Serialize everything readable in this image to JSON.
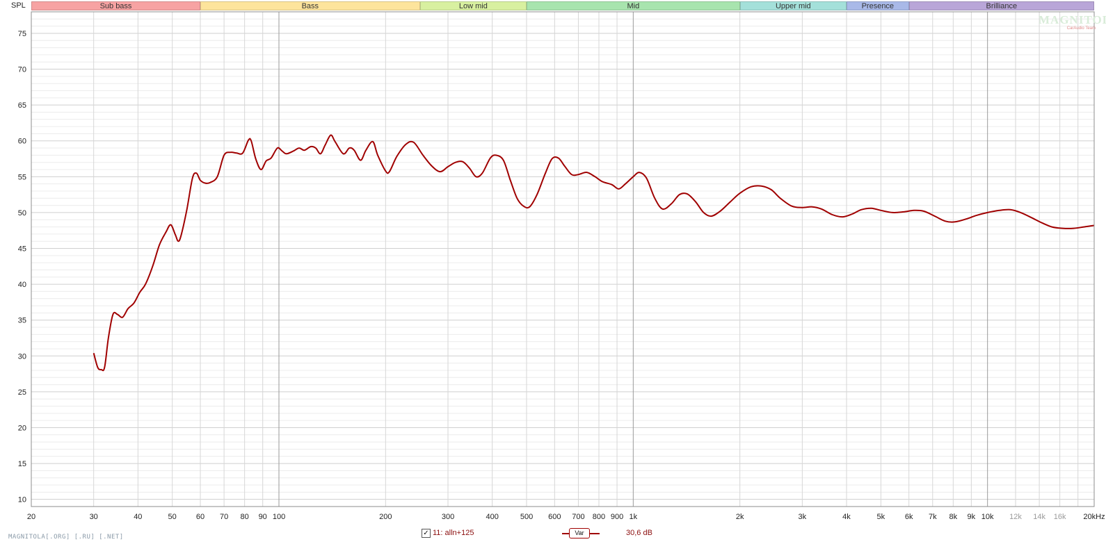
{
  "header": {
    "yaxis_title": "SPL"
  },
  "bands": [
    {
      "label": "Sub bass",
      "from": 20,
      "to": 60,
      "color": "#f7a3a3"
    },
    {
      "label": "Bass",
      "from": 60,
      "to": 250,
      "color": "#fde49c"
    },
    {
      "label": "Low mid",
      "from": 250,
      "to": 500,
      "color": "#d8f0a0"
    },
    {
      "label": "Mid",
      "from": 500,
      "to": 2000,
      "color": "#a8e4ae"
    },
    {
      "label": "Upper mid",
      "from": 2000,
      "to": 4000,
      "color": "#a4e0da"
    },
    {
      "label": "Presence",
      "from": 4000,
      "to": 6000,
      "color": "#a9b9e8"
    },
    {
      "label": "Brilliance",
      "from": 6000,
      "to": 20000,
      "color": "#b9a6d8"
    }
  ],
  "watermark": {
    "main": "MAGNITOLA",
    "sub": "CarAudio Team"
  },
  "footer": {
    "site": "MAGNITOLA[.ORG] [.RU] [.NET]"
  },
  "legend": {
    "checked_mark": "✓",
    "name": "11: alln+125",
    "var_label": "Var",
    "value": "30,6 dB"
  },
  "colors": {
    "curve": "#a00000",
    "grid_minor": "#e6e6e6",
    "grid_major": "#9a9a9a"
  },
  "chart_data": {
    "type": "line",
    "x_scale": "log",
    "xlim": [
      20,
      20000
    ],
    "ylim": [
      9,
      78
    ],
    "ylabel": "SPL",
    "grid": true,
    "y_ticks": [
      10,
      15,
      20,
      25,
      30,
      35,
      40,
      45,
      50,
      55,
      60,
      65,
      70,
      75
    ],
    "x_ticks": [
      {
        "v": 20,
        "label": "20",
        "major": false
      },
      {
        "v": 30,
        "label": "30",
        "major": false
      },
      {
        "v": 40,
        "label": "40",
        "major": false
      },
      {
        "v": 50,
        "label": "50",
        "major": false
      },
      {
        "v": 60,
        "label": "60",
        "major": false
      },
      {
        "v": 70,
        "label": "70",
        "major": false
      },
      {
        "v": 80,
        "label": "80",
        "major": false
      },
      {
        "v": 90,
        "label": "90",
        "major": false
      },
      {
        "v": 100,
        "label": "100",
        "major": true
      },
      {
        "v": 200,
        "label": "200",
        "major": false
      },
      {
        "v": 300,
        "label": "300",
        "major": false
      },
      {
        "v": 400,
        "label": "400",
        "major": false
      },
      {
        "v": 500,
        "label": "500",
        "major": false
      },
      {
        "v": 600,
        "label": "600",
        "major": false
      },
      {
        "v": 700,
        "label": "700",
        "major": false
      },
      {
        "v": 800,
        "label": "800",
        "major": false
      },
      {
        "v": 900,
        "label": "900",
        "major": false
      },
      {
        "v": 1000,
        "label": "1k",
        "major": true
      },
      {
        "v": 2000,
        "label": "2k",
        "major": false
      },
      {
        "v": 3000,
        "label": "3k",
        "major": false
      },
      {
        "v": 4000,
        "label": "4k",
        "major": false
      },
      {
        "v": 5000,
        "label": "5k",
        "major": false
      },
      {
        "v": 6000,
        "label": "6k",
        "major": false
      },
      {
        "v": 7000,
        "label": "7k",
        "major": false
      },
      {
        "v": 8000,
        "label": "8k",
        "major": false
      },
      {
        "v": 9000,
        "label": "9k",
        "major": false
      },
      {
        "v": 10000,
        "label": "10k",
        "major": true
      },
      {
        "v": 12000,
        "label": "12k",
        "major": false,
        "faded": true
      },
      {
        "v": 14000,
        "label": "14k",
        "major": false,
        "faded": true
      },
      {
        "v": 16000,
        "label": "16k",
        "major": false,
        "faded": true
      },
      {
        "v": 20000,
        "label": "20kHz",
        "major": false
      }
    ],
    "series": [
      {
        "name": "11: alln+125",
        "color": "#a00000",
        "points": [
          [
            30,
            30.4
          ],
          [
            30.8,
            28.4
          ],
          [
            31.5,
            28.1
          ],
          [
            32.2,
            28.4
          ],
          [
            33,
            32.5
          ],
          [
            34,
            35.8
          ],
          [
            35,
            35.8
          ],
          [
            36.2,
            35.4
          ],
          [
            37.5,
            36.6
          ],
          [
            39,
            37.4
          ],
          [
            40.5,
            38.9
          ],
          [
            42,
            40.0
          ],
          [
            44,
            42.5
          ],
          [
            46,
            45.5
          ],
          [
            48,
            47.3
          ],
          [
            49.5,
            48.3
          ],
          [
            51,
            46.9
          ],
          [
            52,
            46.0
          ],
          [
            53,
            46.9
          ],
          [
            55,
            50.5
          ],
          [
            57,
            54.8
          ],
          [
            58.5,
            55.5
          ],
          [
            60,
            54.5
          ],
          [
            62,
            54.1
          ],
          [
            64,
            54.2
          ],
          [
            67,
            55.0
          ],
          [
            70,
            58.0
          ],
          [
            73,
            58.4
          ],
          [
            76,
            58.3
          ],
          [
            79,
            58.3
          ],
          [
            82,
            60.1
          ],
          [
            83.5,
            60.0
          ],
          [
            86,
            57.5
          ],
          [
            89,
            56.0
          ],
          [
            92,
            57.2
          ],
          [
            95,
            57.6
          ],
          [
            99,
            59.0
          ],
          [
            102,
            58.6
          ],
          [
            105,
            58.2
          ],
          [
            110,
            58.6
          ],
          [
            114,
            59.0
          ],
          [
            118,
            58.7
          ],
          [
            123,
            59.2
          ],
          [
            127,
            59.0
          ],
          [
            131,
            58.2
          ],
          [
            135,
            59.4
          ],
          [
            140,
            60.8
          ],
          [
            144,
            59.9
          ],
          [
            152,
            58.2
          ],
          [
            158,
            59.0
          ],
          [
            163,
            58.7
          ],
          [
            170,
            57.3
          ],
          [
            176,
            58.7
          ],
          [
            184,
            59.9
          ],
          [
            190,
            58.0
          ],
          [
            200,
            55.8
          ],
          [
            205,
            55.7
          ],
          [
            215,
            57.8
          ],
          [
            228,
            59.5
          ],
          [
            240,
            59.8
          ],
          [
            255,
            58.0
          ],
          [
            270,
            56.5
          ],
          [
            285,
            55.7
          ],
          [
            300,
            56.4
          ],
          [
            315,
            57.0
          ],
          [
            330,
            57.1
          ],
          [
            345,
            56.2
          ],
          [
            360,
            55.0
          ],
          [
            375,
            55.5
          ],
          [
            395,
            57.6
          ],
          [
            410,
            58.0
          ],
          [
            430,
            57.3
          ],
          [
            450,
            54.5
          ],
          [
            470,
            52.0
          ],
          [
            490,
            50.9
          ],
          [
            510,
            50.8
          ],
          [
            535,
            52.5
          ],
          [
            565,
            55.5
          ],
          [
            590,
            57.5
          ],
          [
            615,
            57.6
          ],
          [
            640,
            56.5
          ],
          [
            670,
            55.3
          ],
          [
            700,
            55.3
          ],
          [
            740,
            55.6
          ],
          [
            780,
            55.0
          ],
          [
            820,
            54.3
          ],
          [
            870,
            53.9
          ],
          [
            910,
            53.3
          ],
          [
            950,
            54.0
          ],
          [
            1000,
            55.0
          ],
          [
            1040,
            55.6
          ],
          [
            1090,
            54.8
          ],
          [
            1150,
            52.0
          ],
          [
            1210,
            50.5
          ],
          [
            1280,
            51.2
          ],
          [
            1350,
            52.5
          ],
          [
            1420,
            52.6
          ],
          [
            1500,
            51.5
          ],
          [
            1580,
            50.0
          ],
          [
            1660,
            49.5
          ],
          [
            1760,
            50.2
          ],
          [
            1880,
            51.5
          ],
          [
            2000,
            52.7
          ],
          [
            2150,
            53.6
          ],
          [
            2300,
            53.7
          ],
          [
            2450,
            53.2
          ],
          [
            2600,
            52.0
          ],
          [
            2800,
            50.9
          ],
          [
            3000,
            50.7
          ],
          [
            3200,
            50.8
          ],
          [
            3400,
            50.5
          ],
          [
            3650,
            49.7
          ],
          [
            3900,
            49.4
          ],
          [
            4150,
            49.8
          ],
          [
            4400,
            50.4
          ],
          [
            4700,
            50.6
          ],
          [
            5000,
            50.3
          ],
          [
            5400,
            50.0
          ],
          [
            5800,
            50.1
          ],
          [
            6200,
            50.3
          ],
          [
            6600,
            50.2
          ],
          [
            7100,
            49.5
          ],
          [
            7600,
            48.8
          ],
          [
            8100,
            48.7
          ],
          [
            8700,
            49.1
          ],
          [
            9300,
            49.6
          ],
          [
            10000,
            50.0
          ],
          [
            10800,
            50.3
          ],
          [
            11600,
            50.4
          ],
          [
            12400,
            50.0
          ],
          [
            13300,
            49.3
          ],
          [
            14200,
            48.6
          ],
          [
            15200,
            48.0
          ],
          [
            16300,
            47.8
          ],
          [
            17500,
            47.8
          ],
          [
            18700,
            48.0
          ],
          [
            20000,
            48.2
          ]
        ]
      }
    ]
  }
}
